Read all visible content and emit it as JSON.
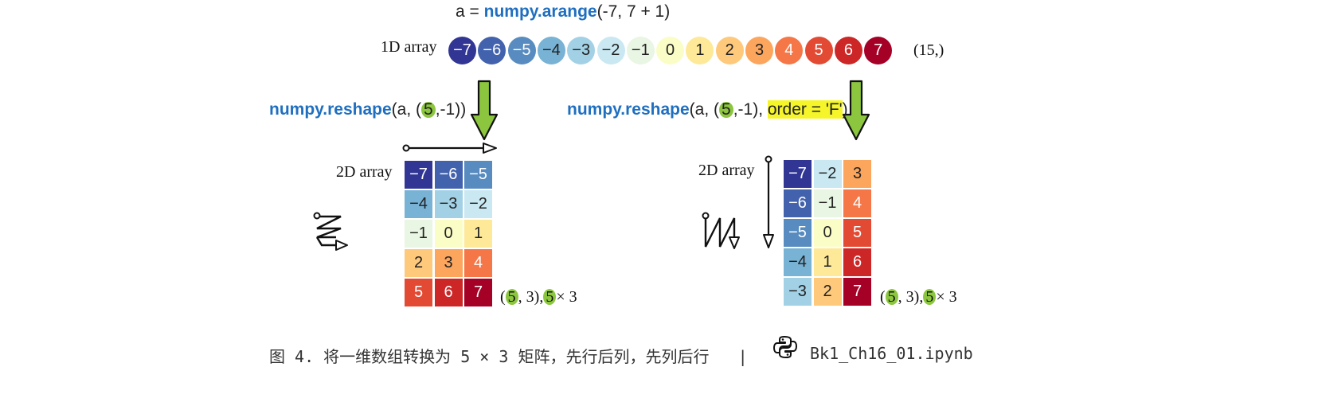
{
  "top_code": {
    "prefix": "a = ",
    "fn": "numpy.arange",
    "args": "(-7, 7 + 1)"
  },
  "array_1d": {
    "label": "1D array",
    "values": [
      "−7",
      "−6",
      "−5",
      "−4",
      "−3",
      "−2",
      "−1",
      "0",
      "1",
      "2",
      "3",
      "4",
      "5",
      "6",
      "7"
    ],
    "shape": "(15,)"
  },
  "colors": [
    "#313695",
    "#4262ad",
    "#588cc0",
    "#78b2d4",
    "#a2d1e5",
    "#c9e8f2",
    "#e8f6e3",
    "#fbfdc7",
    "#fee999",
    "#fec97b",
    "#fca55d",
    "#f57748",
    "#e34a33",
    "#cc2627",
    "#a50026"
  ],
  "text_colors": [
    "#ffffff",
    "#ffffff",
    "#ffffff",
    "#222222",
    "#222222",
    "#222222",
    "#222222",
    "#222222",
    "#222222",
    "#222222",
    "#222222",
    "#ffffff",
    "#ffffff",
    "#ffffff",
    "#ffffff"
  ],
  "left": {
    "code": {
      "fn": "numpy.reshape",
      "open": "(a, (",
      "n": "5",
      "rest": ",-1))"
    },
    "label": "2D array",
    "grid": [
      [
        "−7",
        "−6",
        "−5"
      ],
      [
        "−4",
        "−3",
        "−2"
      ],
      [
        "−1",
        "0",
        "1"
      ],
      [
        "2",
        "3",
        "4"
      ],
      [
        "5",
        "6",
        "7"
      ]
    ],
    "color_index": [
      [
        0,
        1,
        2
      ],
      [
        3,
        4,
        5
      ],
      [
        6,
        7,
        8
      ],
      [
        9,
        10,
        11
      ],
      [
        12,
        13,
        14
      ]
    ],
    "shape": {
      "open": "(",
      "n1": "5",
      "mid": ", 3),",
      "n2": "5",
      "tail": "× 3"
    }
  },
  "right": {
    "code": {
      "fn": "numpy.reshape",
      "open": "(a, (",
      "n": "5",
      "rest": ",-1), ",
      "order": "order = 'F'",
      "close": ")"
    },
    "label": "2D array",
    "grid": [
      [
        "−7",
        "−2",
        "3"
      ],
      [
        "−6",
        "−1",
        "4"
      ],
      [
        "−5",
        "0",
        "5"
      ],
      [
        "−4",
        "1",
        "6"
      ],
      [
        "−3",
        "2",
        "7"
      ]
    ],
    "color_index": [
      [
        0,
        5,
        10
      ],
      [
        1,
        6,
        11
      ],
      [
        2,
        7,
        12
      ],
      [
        3,
        8,
        13
      ],
      [
        4,
        9,
        14
      ]
    ],
    "shape": {
      "open": "(",
      "n1": "5",
      "mid": ", 3),",
      "n2": "5",
      "tail": "× 3"
    }
  },
  "caption": "图 4. 将一维数组转换为 5 × 3 矩阵，先行后列，先列后行",
  "separator": "|",
  "filename": "Bk1_Ch16_01.ipynb",
  "icons": [
    "down-arrow-icon",
    "row-order-arrow-icon",
    "column-order-arrow-icon",
    "zigzag-row-icon",
    "zigzag-column-icon",
    "python-logo-icon"
  ]
}
